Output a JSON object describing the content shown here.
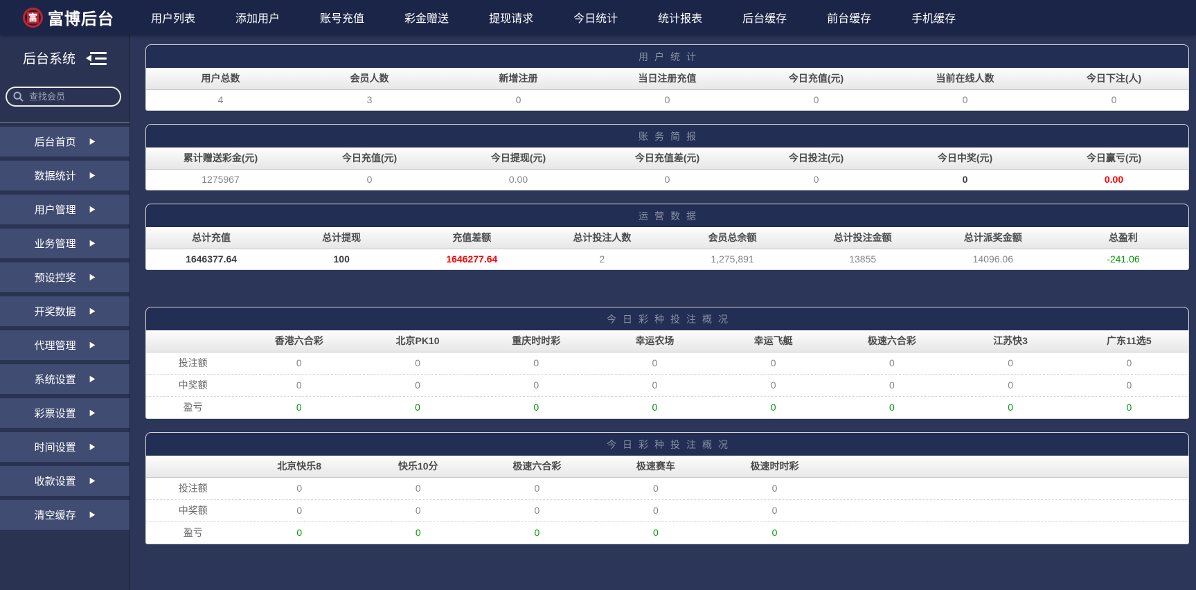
{
  "colors": {
    "navbar_bg": "#1b2547",
    "sidebar_item_bg": "#404c72",
    "panel_title_bg": "#232e54",
    "accent_red": "#c4232b",
    "negative_red": "#ff0000",
    "positive_green": "#009900"
  },
  "navbar": {
    "logo_char": "富",
    "logo_text": "富博后台",
    "items": [
      "用户列表",
      "添加用户",
      "账号充值",
      "彩金赠送",
      "提现请求",
      "今日统计",
      "统计报表",
      "后台缓存",
      "前台缓存",
      "手机缓存"
    ]
  },
  "sidebar": {
    "title": "后台系统",
    "search_placeholder": "查找会员",
    "items": [
      "后台首页",
      "数据统计",
      "用户管理",
      "业务管理",
      "预设控奖",
      "开奖数据",
      "代理管理",
      "系统设置",
      "彩票设置",
      "时间设置",
      "收款设置",
      "清空缓存"
    ]
  },
  "panels": [
    {
      "kind": "summary",
      "name": "user-stats",
      "title": "用户统计",
      "headers": [
        "用户总数",
        "会员人数",
        "新增注册",
        "当日注册充值",
        "今日充值(元)",
        "当前在线人数",
        "今日下注(人)"
      ],
      "values": [
        "4",
        "3",
        "0",
        "0",
        "0",
        "0",
        "0"
      ],
      "styles": [
        "",
        "",
        "",
        "",
        "",
        "",
        ""
      ]
    },
    {
      "kind": "summary",
      "name": "finance-brief",
      "title": "账务简报",
      "headers": [
        "累计赠送彩金(元)",
        "今日充值(元)",
        "今日提现(元)",
        "今日充值差(元)",
        "今日投注(元)",
        "今日中奖(元)",
        "今日赢亏(元)"
      ],
      "values": [
        "1275967",
        "0",
        "0.00",
        "0",
        "0",
        "0",
        "0.00"
      ],
      "styles": [
        "",
        "",
        "",
        "",
        "",
        "bold",
        "redbold"
      ]
    },
    {
      "kind": "summary",
      "name": "operation-data",
      "title": "运营数据",
      "headers": [
        "总计充值",
        "总计提现",
        "充值差额",
        "总计投注人数",
        "会员总余额",
        "总计投注金额",
        "总计派奖金额",
        "总盈利"
      ],
      "values": [
        "1646377.64",
        "100",
        "1646277.64",
        "2",
        "1,275,891",
        "13855",
        "14096.06",
        "-241.06"
      ],
      "styles": [
        "bold",
        "bold",
        "redbold",
        "",
        "",
        "",
        "",
        "green"
      ]
    },
    {
      "kind": "matrix",
      "name": "today-lottery-bets-1",
      "title": "今日彩种投注概况",
      "gap_before": true,
      "filler": false,
      "columns": [
        "香港六合彩",
        "北京PK10",
        "重庆时时彩",
        "幸运农场",
        "幸运飞艇",
        "极速六合彩",
        "江苏快3",
        "广东11选5"
      ],
      "rows": [
        {
          "label": "投注额",
          "style": "",
          "values": [
            "0",
            "0",
            "0",
            "0",
            "0",
            "0",
            "0",
            "0"
          ]
        },
        {
          "label": "中奖额",
          "style": "",
          "values": [
            "0",
            "0",
            "0",
            "0",
            "0",
            "0",
            "0",
            "0"
          ]
        },
        {
          "label": "盈亏",
          "style": "green",
          "values": [
            "0",
            "0",
            "0",
            "0",
            "0",
            "0",
            "0",
            "0"
          ]
        }
      ]
    },
    {
      "kind": "matrix",
      "name": "today-lottery-bets-2",
      "title": "今日彩种投注概况",
      "gap_before": false,
      "filler": true,
      "columns": [
        "北京快乐8",
        "快乐10分",
        "极速六合彩",
        "极速赛车",
        "极速时时彩"
      ],
      "rows": [
        {
          "label": "投注额",
          "style": "",
          "values": [
            "0",
            "0",
            "0",
            "0",
            "0"
          ]
        },
        {
          "label": "中奖额",
          "style": "",
          "values": [
            "0",
            "0",
            "0",
            "0",
            "0"
          ]
        },
        {
          "label": "盈亏",
          "style": "green",
          "values": [
            "0",
            "0",
            "0",
            "0",
            "0"
          ]
        }
      ]
    }
  ]
}
